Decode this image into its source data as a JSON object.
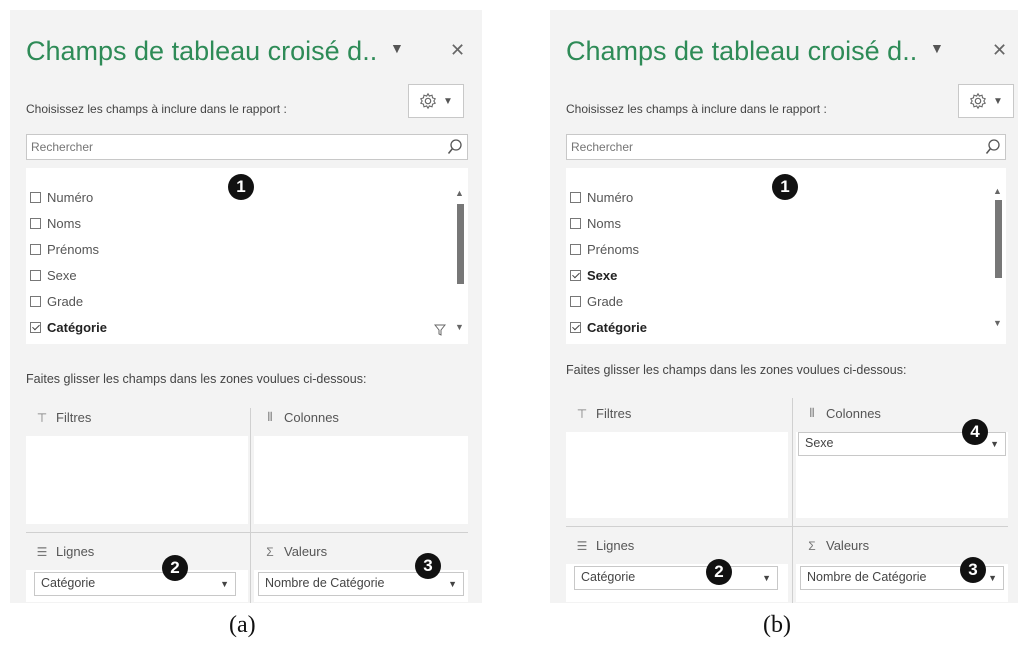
{
  "panels": [
    {
      "title": "Champs de tableau croisé d..",
      "subtitle": "Choisissez les champs à inclure dans le rapport :",
      "search_placeholder": "Rechercher",
      "fields": [
        {
          "label": "Numéro",
          "checked": false
        },
        {
          "label": "Noms",
          "checked": false
        },
        {
          "label": "Prénoms",
          "checked": false
        },
        {
          "label": "Sexe",
          "checked": false
        },
        {
          "label": "Grade",
          "checked": false
        },
        {
          "label": "Catégorie",
          "checked": true
        }
      ],
      "instruction": "Faites glisser les champs dans les zones voulues ci-dessous:",
      "areas": {
        "filters_label": "Filtres",
        "columns_label": "Colonnes",
        "rows_label": "Lignes",
        "values_label": "Valeurs",
        "rows_chip": "Catégorie",
        "values_chip": "Nombre de Catégorie"
      },
      "badges": [
        "1",
        "2",
        "3"
      ],
      "caption": "(a)"
    },
    {
      "title": "Champs de tableau croisé d..",
      "subtitle": "Choisissez les champs à inclure dans le rapport :",
      "search_placeholder": "Rechercher",
      "fields": [
        {
          "label": "Numéro",
          "checked": false
        },
        {
          "label": "Noms",
          "checked": false
        },
        {
          "label": "Prénoms",
          "checked": false
        },
        {
          "label": "Sexe",
          "checked": true
        },
        {
          "label": "Grade",
          "checked": false
        },
        {
          "label": "Catégorie",
          "checked": true
        }
      ],
      "instruction": "Faites glisser les champs dans les zones voulues ci-dessous:",
      "areas": {
        "filters_label": "Filtres",
        "columns_label": "Colonnes",
        "rows_label": "Lignes",
        "values_label": "Valeurs",
        "columns_chip": "Sexe",
        "rows_chip": "Catégorie",
        "values_chip": "Nombre de Catégorie"
      },
      "badges": [
        "1",
        "2",
        "3",
        "4"
      ],
      "caption": "(b)"
    }
  ],
  "colors": {
    "title": "#2e8b57",
    "panel_bg": "#f3f3f3",
    "badge": "#111111"
  },
  "icons": [
    "settings-gear-icon",
    "search-icon",
    "filter-icon",
    "columns-icon",
    "rows-icon",
    "sigma-icon",
    "close-icon",
    "chevron-down-icon"
  ]
}
